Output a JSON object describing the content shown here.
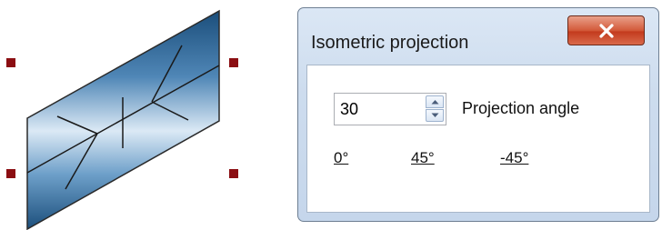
{
  "dialog": {
    "title": "Isometric projection",
    "close_label": "X"
  },
  "angle": {
    "value": "30",
    "label": "Projection angle"
  },
  "presets": [
    "0°",
    "45°",
    "-45°"
  ],
  "colors": {
    "handle": "#8b0e12",
    "shape_dark": "#1c4f7c",
    "shape_light": "#ddeaf6",
    "close_button": "#c9452a",
    "dialog_frame": "#cddcee"
  },
  "icons": {
    "close": "close-icon",
    "spin_up": "chevron-up-icon",
    "spin_down": "chevron-down-icon"
  }
}
